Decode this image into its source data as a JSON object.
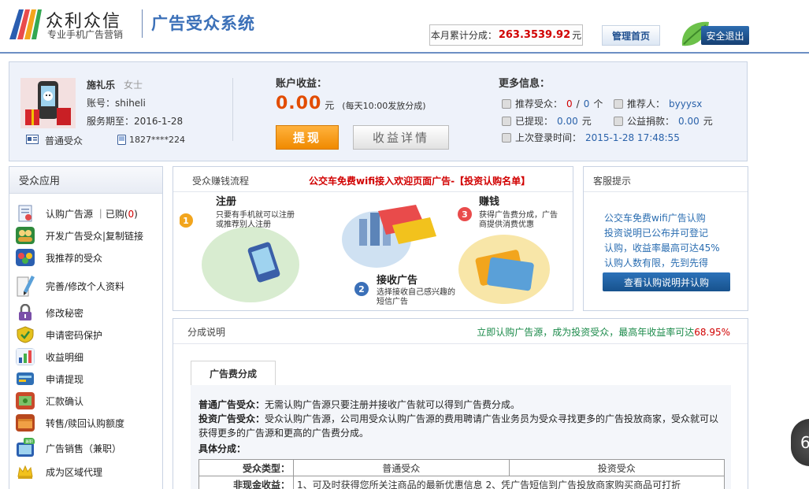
{
  "header": {
    "brand_name": "众利众信",
    "brand_slogan": "专业手机广告营销",
    "system_name": "广告受众系统",
    "monthly_label": "本月累计分成：",
    "monthly_value": "263.3539.92",
    "monthly_unit": "元",
    "home_label": "管理首页",
    "exit_label": "安全退出"
  },
  "account": {
    "user_name": "施礼乐",
    "user_gender": "女士",
    "account_line": "账号：shiheli",
    "expiry_line": "服务期至：2016-1-28",
    "user_type": "普通受众",
    "phone": "1827****224",
    "earn_label": "账户收益：",
    "earn_value": "0.00",
    "earn_unit": "元",
    "earn_note": "(每天10:00发放分成)",
    "withdraw_label": "提现",
    "detail_label": "收益详情",
    "more_label": "更多信息：",
    "ref_users_label": "推荐受众：",
    "ref_users_value": "0",
    "ref_users_sep": "/",
    "ref_users_total": "0",
    "ref_users_unit": "个",
    "referrer_label": "推荐人：",
    "referrer_value": "byyysx",
    "withdrawn_label": "已提现：",
    "withdrawn_value": "0.00",
    "withdrawn_unit": "元",
    "donation_label": "公益捐款：",
    "donation_value": "0.00",
    "donation_unit": "元",
    "last_login_label": "上次登录时间：",
    "last_login_value": "2015-1-28 17:48:55"
  },
  "sidebar": {
    "title": "受众应用",
    "items": [
      {
        "label": "认购广告源 ｜已购",
        "count": "0",
        "icon": "document-icon"
      },
      {
        "label": "开发广告受众|复制链接",
        "icon": "users-icon"
      },
      {
        "label": "我推荐的受众",
        "icon": "group-icon"
      },
      {
        "label": "完善/修改个人资料",
        "icon": "pencil-icon"
      },
      {
        "label": "修改秘密",
        "icon": "lock-icon"
      },
      {
        "label": "申请密码保护",
        "icon": "shield-icon"
      },
      {
        "label": "收益明细",
        "icon": "chart-icon"
      },
      {
        "label": "申请提现",
        "icon": "wallet-icon"
      },
      {
        "label": "汇款确认",
        "icon": "money-icon"
      },
      {
        "label": "转售/赎回认购额度",
        "icon": "box-icon"
      },
      {
        "label": "广告销售（兼职）",
        "badge": "兼职",
        "icon": "tv-icon"
      },
      {
        "label": "成为区域代理",
        "icon": "crown-icon"
      }
    ]
  },
  "flow": {
    "title": "受众赚钱流程",
    "promo": "公交车免费wifi接入欢迎页面广告-【投资认购名单】",
    "step1_num": "1",
    "step1_title": "注册",
    "step1_desc1": "只要有手机就可以注册",
    "step1_desc2": "或推荐别人注册",
    "step2_num": "2",
    "step2_title": "接收广告",
    "step2_desc1": "选择接收自己感兴趣的",
    "step2_desc2": "短信广告",
    "step3_num": "3",
    "step3_title": "赚钱",
    "step3_desc1": "获得广告费分成，广告",
    "step3_desc2": "商提供消费优惠"
  },
  "service": {
    "title": "客服提示",
    "line1": "公交车免费wifi广告认购",
    "line2": "投资说明已公布并可登记",
    "line3": "认购，收益率最高可达45%",
    "line4": "认购人数有限，先到先得",
    "button": "查看认购说明并认购"
  },
  "share": {
    "title": "分成说明",
    "promo_prefix": "立即认购广告源，成为投资受众，最高年收益率可达",
    "promo_rate": "68.95%",
    "tab": "广告费分成",
    "p1_bold": "普通广告受众：",
    "p1_text": "无需认购广告源只要注册并接收广告就可以得到广告费分成。",
    "p2_bold": "投资广告受众：",
    "p2_text": "受众认购广告源，公司用受众认购广告源的费用聘请广告业务员为受众寻找更多的广告投放商家，受众就可以获得更多的广告源和更高的广告费分成。",
    "p3_bold": "具体分成：",
    "table_h0": "受众类型：",
    "table_h1": "普通受众",
    "table_h2": "投资受众",
    "table_r1_0": "非现金收益：",
    "table_r1_1": "1、可及时获得您所关注商品的最新优惠信息 2、凭广告短信到广告投放商家购买商品可打折"
  },
  "float_widget": {
    "text": "6"
  }
}
